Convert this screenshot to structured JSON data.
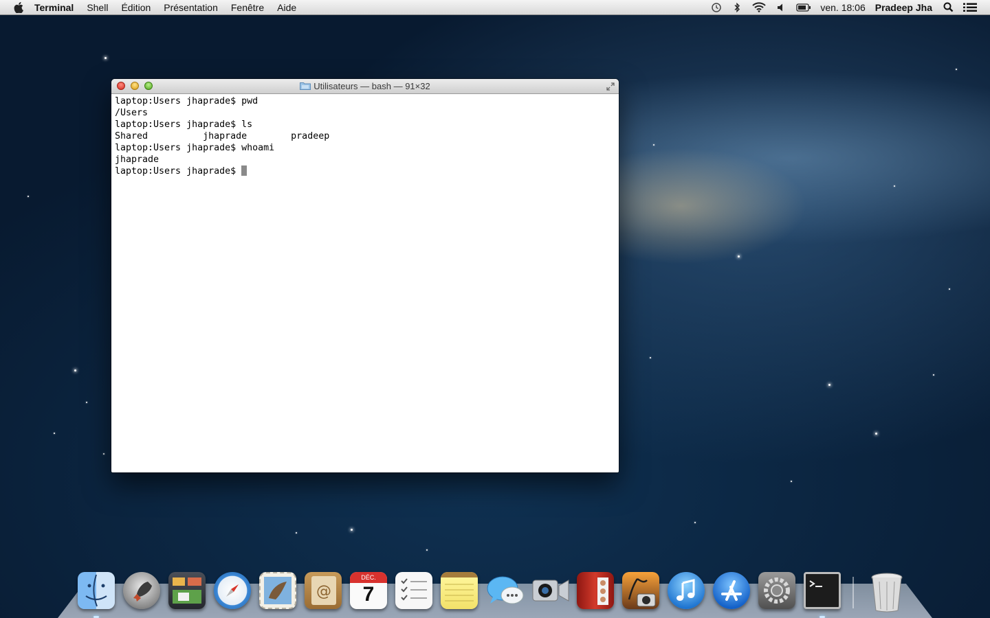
{
  "menubar": {
    "apple_icon": "apple-logo-icon",
    "app_name": "Terminal",
    "menus": [
      "Shell",
      "Édition",
      "Présentation",
      "Fenêtre",
      "Aide"
    ],
    "status_icons": [
      "time-machine-icon",
      "bluetooth-icon",
      "wifi-icon",
      "volume-icon",
      "battery-icon"
    ],
    "clock": "ven. 18:06",
    "user": "Pradeep Jha",
    "right_icons": [
      "spotlight-search-icon",
      "notification-center-icon"
    ]
  },
  "terminal": {
    "title": "Utilisateurs — bash — 91×32",
    "lines": [
      "laptop:Users jhapradeǃ pwd",
      "/Users",
      "laptop:Users jhapradeǃ ls",
      "Shared          jhaprade        pradeep",
      "laptop:Users jhapradeǃ whoami",
      "jhaprade",
      "laptop:Users jhapradeǃ "
    ]
  },
  "dock": {
    "apps": [
      "Finder",
      "Launchpad",
      "Mission Control",
      "Safari",
      "Mail",
      "Contacts",
      "Calendar",
      "Reminders",
      "Notes",
      "Messages",
      "FaceTime",
      "Photo Booth",
      "iPhoto",
      "iTunes",
      "App Store",
      "System Preferences",
      "Terminal"
    ],
    "calendar_month": "DÉC.",
    "calendar_day": "7",
    "trash": "Trash"
  },
  "colors": {
    "desktop_dark": "#081a30",
    "menubar_top": "#f4f4f4",
    "terminal_bg": "#ffffff",
    "cursor": "#8a8a8a"
  }
}
